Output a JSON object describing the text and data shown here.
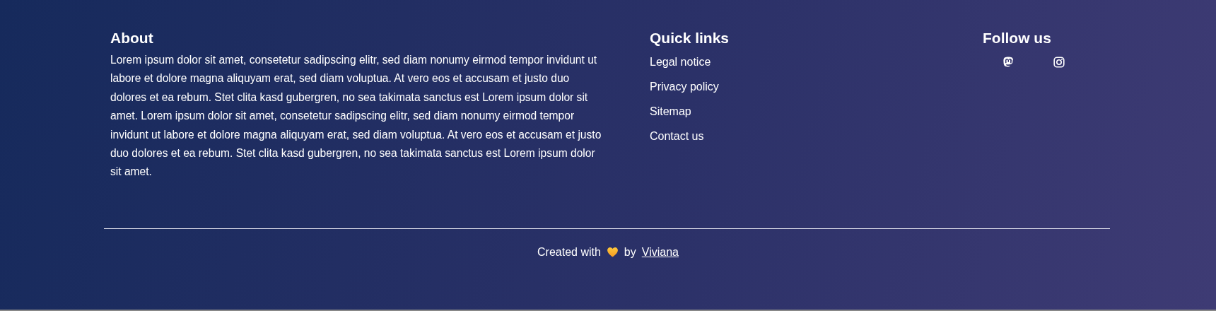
{
  "about": {
    "title": "About",
    "text": "Lorem ipsum dolor sit amet, consetetur sadipscing elitr, sed diam nonumy eirmod tempor invidunt ut labore et dolore magna aliquyam erat, sed diam voluptua. At vero eos et accusam et justo duo dolores et ea rebum. Stet clita kasd gubergren, no sea takimata sanctus est Lorem ipsum dolor sit amet. Lorem ipsum dolor sit amet, consetetur sadipscing elitr, sed diam nonumy eirmod tempor invidunt ut labore et dolore magna aliquyam erat, sed diam voluptua. At vero eos et accusam et justo duo dolores et ea rebum. Stet clita kasd gubergren, no sea takimata sanctus est Lorem ipsum dolor sit amet."
  },
  "quick_links": {
    "title": "Quick links",
    "links": [
      "Legal notice",
      "Privacy policy",
      "Sitemap",
      "Contact us"
    ]
  },
  "follow": {
    "title": "Follow us",
    "icons": [
      {
        "kind": "mastodon"
      },
      {
        "kind": "instagram"
      }
    ]
  },
  "credit": {
    "before": "Created with",
    "after": "by",
    "author": "Viviana"
  }
}
